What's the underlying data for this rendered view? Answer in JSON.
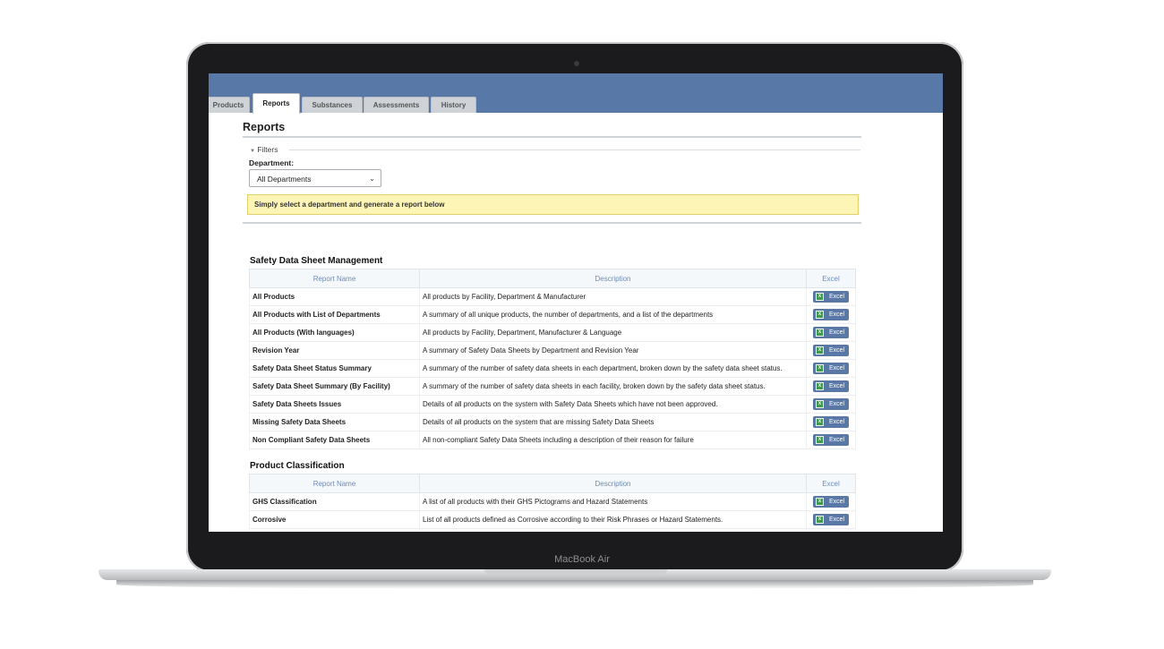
{
  "device": {
    "label": "MacBook Air"
  },
  "tabs": [
    {
      "label": "Products",
      "active": false
    },
    {
      "label": "Reports",
      "active": true
    },
    {
      "label": "Substances",
      "active": false
    },
    {
      "label": "Assessments",
      "active": false
    },
    {
      "label": "History",
      "active": false
    }
  ],
  "page": {
    "title": "Reports",
    "filters_label": "Filters",
    "department_label": "Department:",
    "department_value": "All Departments",
    "notice": "Simply select a department and generate a report below"
  },
  "table_headers": {
    "name": "Report Name",
    "description": "Description",
    "excel": "Excel"
  },
  "excel_button_label": "Excel",
  "sections": [
    {
      "title": "Safety Data Sheet Management",
      "rows": [
        {
          "name": "All Products",
          "description": "All products by Facility, Department & Manufacturer"
        },
        {
          "name": "All Products with List of Departments",
          "description": "A summary of all unique products, the number of departments, and a list of the departments"
        },
        {
          "name": "All Products (With languages)",
          "description": "All products by Facility, Department, Manufacturer & Language"
        },
        {
          "name": "Revision Year",
          "description": "A summary of Safety Data Sheets by Department and Revision Year"
        },
        {
          "name": "Safety Data Sheet Status Summary",
          "description": "A summary of the number of safety data sheets in each department, broken down by the safety data sheet status."
        },
        {
          "name": "Safety Data Sheet Summary (By Facility)",
          "description": "A summary of the number of safety data sheets in each facility, broken down by the safety data sheet status."
        },
        {
          "name": "Safety Data Sheets Issues",
          "description": "Details of all products on the system with Safety Data Sheets which have not been approved."
        },
        {
          "name": "Missing Safety Data Sheets",
          "description": "Details of all products on the system that are missing Safety Data Sheets"
        },
        {
          "name": "Non Compliant Safety Data Sheets",
          "description": "All non-compliant Safety Data Sheets including a description of their reason for failure"
        }
      ]
    },
    {
      "title": "Product Classification",
      "rows": [
        {
          "name": "GHS Classification",
          "description": "A list of all products with their GHS Pictograms and Hazard Statements"
        },
        {
          "name": "Corrosive",
          "description": "List of all products defined as Corrosive according to their Risk Phrases or Hazard Statements."
        }
      ]
    }
  ]
}
